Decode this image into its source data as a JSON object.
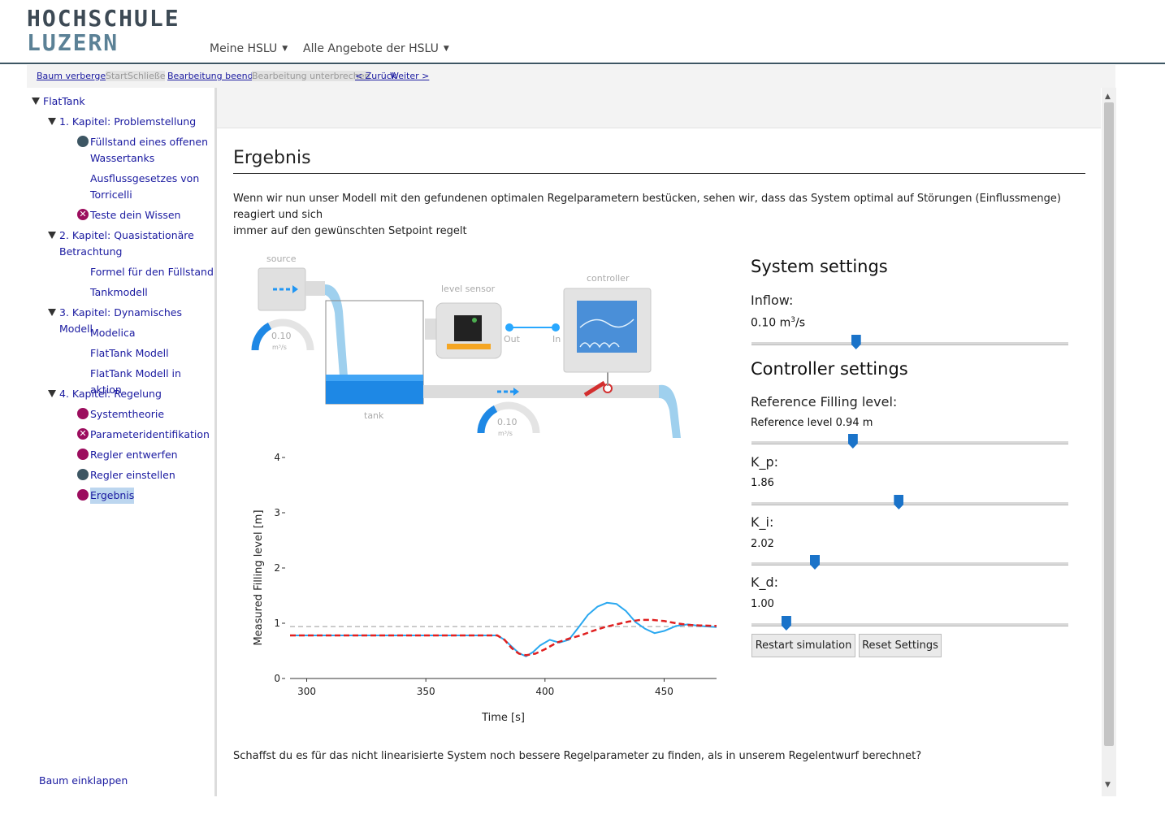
{
  "header": {
    "logo_line1": "HOCHSCHULE",
    "logo_line2": "LUZERN",
    "nav": [
      {
        "label": "Meine HSLU"
      },
      {
        "label": "Alle Angebote der HSLU"
      }
    ]
  },
  "toolbar": {
    "hide_tree": "Baum verbergen",
    "start": "Start",
    "close": "Schließen",
    "end_edit": "Bearbeitung beenden",
    "pause_edit": "Bearbeitung unterbrechen",
    "back": "< Zurück",
    "next": "Weiter >"
  },
  "sidebar": {
    "root": "FlatTank",
    "ch1": "1. Kapitel: Problemstellung",
    "ch1_items": [
      "Füllstand eines offenen",
      "Wassertanks",
      "Ausflussgesetzes von",
      "Torricelli",
      "Teste dein Wissen"
    ],
    "ch2_line1": "2. Kapitel: Quasistationäre",
    "ch2_line2": "Betrachtung",
    "ch2_items": [
      "Formel für den Füllstand",
      "Tankmodell"
    ],
    "ch3": "3. Kapitel: Dynamisches Modell",
    "ch3_items": [
      "Modelica",
      "FlatTank Modell",
      "FlatTank Modell in aktion"
    ],
    "ch4": "4. Kapitel: Regelung",
    "ch4_items": [
      "Systemtheorie",
      "Parameteridentifikation",
      "Regler entwerfen",
      "Regler einstellen",
      "Ergebnis"
    ],
    "collapse": "Baum einklappen"
  },
  "content": {
    "heading": "Ergebnis",
    "intro_line1": "Wenn wir nun unser Modell mit den gefundenen optimalen Regelparametern bestücken, sehen wir, dass das System optimal auf Störungen (Einflussmenge) reagiert und sich",
    "intro_line2": "immer auf den gewünschten Setpoint regelt",
    "outro": "Schaffst du es für das nicht linearisierte System noch bessere Regelparameter zu finden, als in unserem Regelentwurf berechnet?"
  },
  "diagram": {
    "source": "source",
    "level_sensor": "level sensor",
    "controller": "controller",
    "tank": "tank",
    "out": "Out",
    "in": "In",
    "gauge1_value": "0.10",
    "gauge1_unit": "m³/s",
    "gauge2_value": "0.10",
    "gauge2_unit": "m³/s"
  },
  "settings": {
    "system_title": "System settings",
    "inflow_label": "Inflow:",
    "inflow_value": "0.10",
    "inflow_unit_base": " m",
    "inflow_unit_exp": "3",
    "inflow_unit_tail": "/s",
    "inflow_level": 0.33,
    "controller_title": "Controller settings",
    "ref_label": "Reference Filling level:",
    "ref_value": "Reference level 0.94 m",
    "ref_level": 0.32,
    "kp_label": "K_p:",
    "kp_value": "1.86",
    "kp_level": 0.465,
    "ki_label": "K_i:",
    "ki_value": "2.02",
    "ki_level": 0.2,
    "kd_label": "K_d:",
    "kd_value": "1.00",
    "kd_level": 0.11,
    "restart": "Restart simulation",
    "reset": "Reset Settings"
  },
  "colors": {
    "accent": "#1a73c9",
    "measured": "#2aa8f0",
    "reference": "#e02020",
    "setpoint": "#bbbbbb",
    "brand_dark": "#3d5663",
    "completed": "#9c0d5e"
  },
  "chart_data": {
    "type": "line",
    "xlabel": "Time [s]",
    "ylabel": "Measured Filling level [m]",
    "xlim": [
      293,
      472
    ],
    "ylim": [
      0,
      4
    ],
    "xticks": [
      "300",
      "350",
      "400",
      "450"
    ],
    "yticks": [
      "0",
      "1",
      "2",
      "3",
      "4"
    ],
    "series": [
      {
        "x": [
          293,
          300,
          320,
          340,
          360,
          380,
          383,
          386,
          389,
          392,
          395,
          398,
          402,
          406,
          410,
          414,
          418,
          422,
          426,
          430,
          434,
          438,
          442,
          446,
          450,
          455,
          460,
          465,
          472
        ],
        "y": [
          0.78,
          0.78,
          0.78,
          0.78,
          0.78,
          0.78,
          0.7,
          0.58,
          0.46,
          0.4,
          0.48,
          0.6,
          0.7,
          0.65,
          0.7,
          0.92,
          1.15,
          1.3,
          1.37,
          1.35,
          1.22,
          1.02,
          0.9,
          0.82,
          0.86,
          0.95,
          0.98,
          0.95,
          0.93
        ]
      },
      {
        "x": [
          293,
          300,
          320,
          340,
          360,
          380,
          383,
          386,
          389,
          392,
          396,
          400,
          405,
          410,
          415,
          420,
          425,
          430,
          435,
          440,
          445,
          450,
          455,
          460,
          465,
          472
        ],
        "y": [
          0.78,
          0.78,
          0.78,
          0.78,
          0.78,
          0.78,
          0.7,
          0.55,
          0.45,
          0.42,
          0.45,
          0.53,
          0.65,
          0.72,
          0.78,
          0.86,
          0.93,
          0.98,
          1.03,
          1.06,
          1.06,
          1.04,
          1.0,
          0.97,
          0.96,
          0.95
        ]
      },
      {
        "x": [
          293,
          472
        ],
        "y": [
          0.94,
          0.94
        ]
      }
    ]
  }
}
